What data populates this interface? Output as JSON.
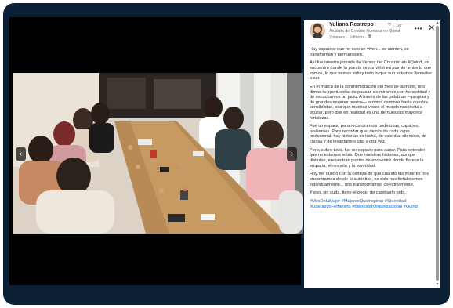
{
  "post": {
    "author": "Yuliana Restrepo",
    "connection": "1er",
    "headline": "Analista de Gestión Humana en Quind",
    "time": "2 meses",
    "edited": "Editado",
    "paragraphs": [
      "Hay espacios que no solo se viven... se sienten, se transforman y permanecen.",
      "Así fue nuestra jornada de Versos del Corazón en #Quind, un encuentro donde la poesía se convirtió en puente: entre lo que somos, lo que hemos sido y todo lo que sun estamos llamadas a ser.",
      "En el marco de la conmemoración del mes de la mujer, nos dimos la oportunidad de pausar, de miramos con honestidad y de escucharnos un jacio. A través de las palabras —propias y de grandes mujeres poetas— atrimos caminos hacia nuestra sensibilidad, esa que muchas veces el mundo nos invita a ocultar, pero que en realidad es una de nuestras mayores fortalezas.",
      "Fue un espacio para reconocernos poderosas, capaces, resilientes. Para recordar que, detrás de cada logro profesional, hay historias de lucha, de valentía, silencios, de caídas y de levantarnos una y otra vez.",
      "Pero, sobre todo, fue un espacio para sanar. Para entender que no estamos solas. Que nuestras historias, aunque distintas, encuentran puntos de encuentro donde florece la empatía, el respeto y la sororidad.",
      "Hoy me quedo con la certeza de que cuando las mujeres nos encontramos desde lo auténtico, no solo nos fortalecemos individualmente... nos transformamos colectivamente.",
      "Y eso, sin duda, tiene el poder de cambiarlo todo."
    ],
    "hashtags": "#MesDelaMujer #MujeresQueInspiran #Sororidad #LiderazgoFemenino #BienestarOrganizacional #Quind"
  },
  "icons": {
    "more": "more-options-icon",
    "close": "close-icon",
    "visibility": "globe-icon",
    "connection": "shield-icon",
    "prev": "chevron-left-icon",
    "next": "chevron-right-icon"
  }
}
